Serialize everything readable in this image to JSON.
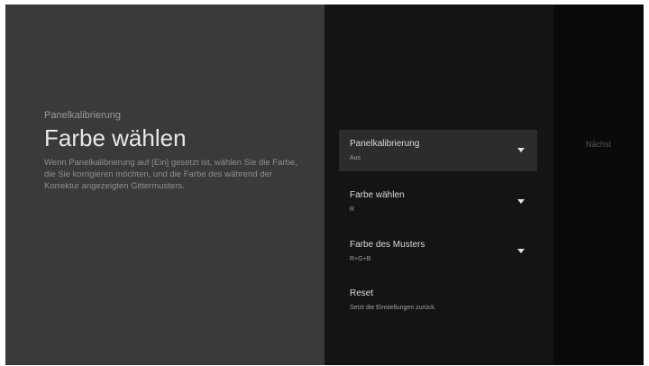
{
  "info": {
    "section": "Panelkalibrierung",
    "title": "Farbe wählen",
    "description": "Wenn Panelkalibrierung auf [Ein] gesetzt ist, wählen Sie die Farbe, die Sie korrigieren möchten, und die Farbe des während der Korrektur angezeigten Gittermusters."
  },
  "menu": {
    "items": [
      {
        "label": "Panelkalibrierung",
        "value": "Aus"
      },
      {
        "label": "Farbe wählen",
        "value": "R"
      },
      {
        "label": "Farbe des Musters",
        "value": "R+G+B"
      },
      {
        "label": "Reset",
        "value": "Setzt die Einstellungen zurück."
      }
    ]
  },
  "next": {
    "label": "Nächst"
  },
  "colors": {
    "left_panel": "#3a3a3a",
    "menu_bg": "#141414",
    "selected_bg": "#2c2c2c"
  }
}
